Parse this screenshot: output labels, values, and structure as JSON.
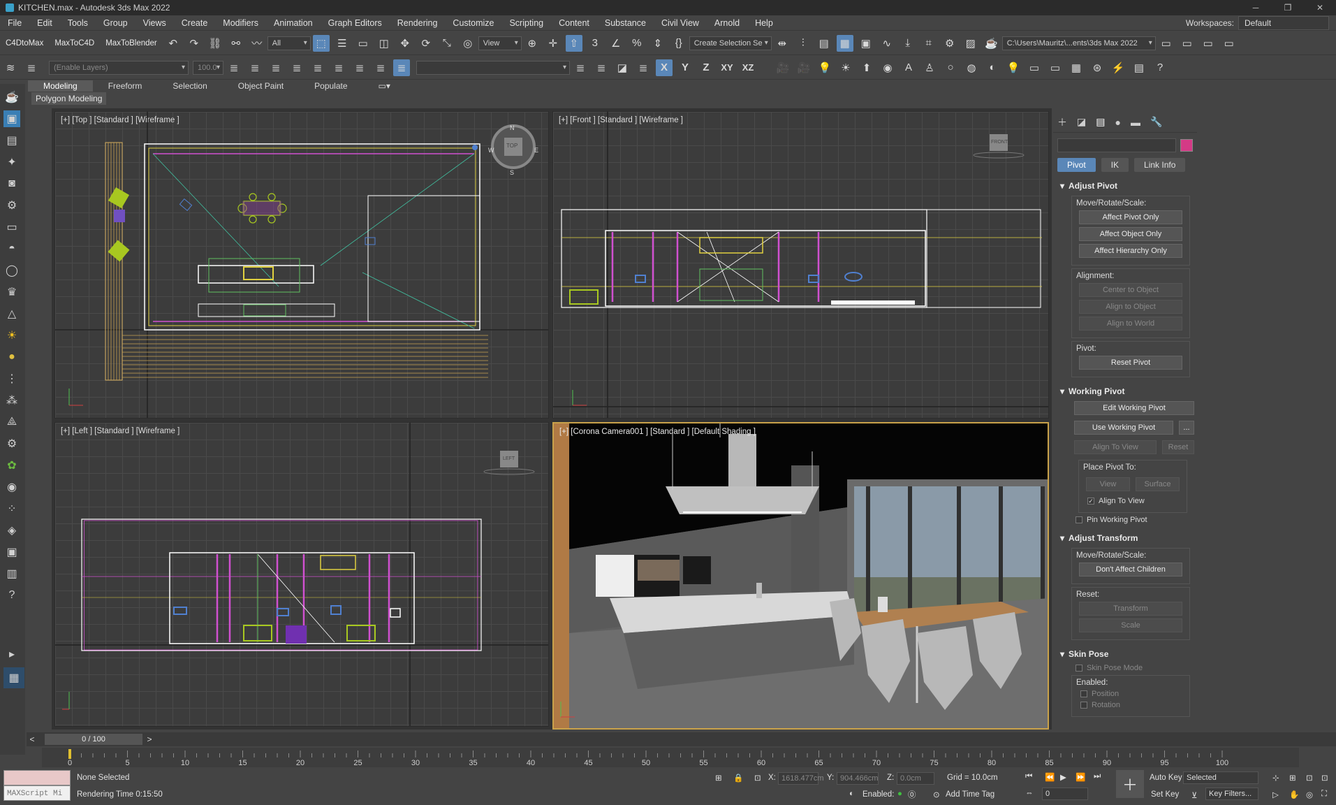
{
  "title": "KITCHEN.max - Autodesk 3ds Max 2022",
  "menu": [
    "File",
    "Edit",
    "Tools",
    "Group",
    "Views",
    "Create",
    "Modifiers",
    "Animation",
    "Graph Editors",
    "Rendering",
    "Customize",
    "Scripting",
    "Content",
    "Substance",
    "Civil View",
    "Arnold",
    "Help"
  ],
  "workspaces_label": "Workspaces:",
  "workspaces_value": "Default",
  "toolbar": {
    "c4d_to_max": "C4DtoMax",
    "max_to_c4d": "MaxToC4D",
    "max_to_blender": "MaxToBlender",
    "filter_value": "All",
    "ref_coord": "View",
    "create_selection": "Create Selection Se",
    "path": "C:\\Users\\Mauritz\\...ents\\3ds Max 2022",
    "enable_layers_placeholder": "(Enable Layers)",
    "layer_value": "100.0"
  },
  "axes": [
    "X",
    "Y",
    "Z",
    "XY",
    "XZ"
  ],
  "ribbon_tabs": [
    "Modeling",
    "Freeform",
    "Selection",
    "Object Paint",
    "Populate"
  ],
  "ribbon_sub": "Polygon Modeling",
  "viewports": {
    "top": "[+] [Top ] [Standard ] [Wireframe ]",
    "front": "[+] [Front ] [Standard ] [Wireframe ]",
    "left": "[+] [Left ] [Standard ] [Wireframe ]",
    "camera": "[+] [Corona Camera001 ] [Standard ] [Default Shading ]"
  },
  "viewcube": {
    "top": "TOP",
    "front": "FRONT",
    "left": "LEFT",
    "n": "N",
    "s": "S",
    "w": "W",
    "e": "E"
  },
  "command_panel": {
    "tabs": [
      "Pivot",
      "IK",
      "Link Info"
    ],
    "adjust_pivot": {
      "title": "Adjust Pivot",
      "move_label": "Move/Rotate/Scale:",
      "buttons": [
        "Affect Pivot Only",
        "Affect Object Only",
        "Affect Hierarchy Only"
      ],
      "alignment_label": "Alignment:",
      "align_buttons": [
        "Center to Object",
        "Align to Object",
        "Align to World"
      ],
      "pivot_label": "Pivot:",
      "reset_pivot": "Reset Pivot"
    },
    "working_pivot": {
      "title": "Working Pivot",
      "edit": "Edit Working Pivot",
      "use": "Use Working Pivot",
      "use_more": "...",
      "align_to_view": "Align To View",
      "reset": "Reset",
      "place_label": "Place Pivot To:",
      "view": "View",
      "surface": "Surface",
      "align_to_view_chk": "Align To View",
      "pin": "Pin Working Pivot"
    },
    "adjust_transform": {
      "title": "Adjust Transform",
      "move_label": "Move/Rotate/Scale:",
      "dont_affect": "Don't Affect Children",
      "reset_label": "Reset:",
      "transform": "Transform",
      "scale": "Scale"
    },
    "skin_pose": {
      "title": "Skin Pose",
      "mode": "Skin Pose Mode",
      "enabled": "Enabled:",
      "position": "Position",
      "rotation": "Rotation"
    }
  },
  "timeline": {
    "frame": "0 / 100",
    "ticks": [
      "0",
      "5",
      "10",
      "15",
      "20",
      "25",
      "30",
      "35",
      "40",
      "45",
      "50",
      "55",
      "60",
      "65",
      "70",
      "75",
      "80",
      "85",
      "90",
      "95",
      "100"
    ],
    "progress": 0
  },
  "status": {
    "maxscript": "MAXScript Mi",
    "selection": "None Selected",
    "render_time": "Rendering Time  0:15:50",
    "x_label": "X:",
    "x_value": "1618.477cm",
    "y_label": "Y:",
    "y_value": "904.466cm",
    "z_label": "Z:",
    "z_value": "0.0cm",
    "grid": "Grid = 10.0cm",
    "enabled": "Enabled:",
    "add_time_tag": "Add Time Tag",
    "auto_key": "Auto Key",
    "set_key": "Set Key",
    "selected": "Selected",
    "key_filters": "Key Filters...",
    "frame_value": "0"
  }
}
